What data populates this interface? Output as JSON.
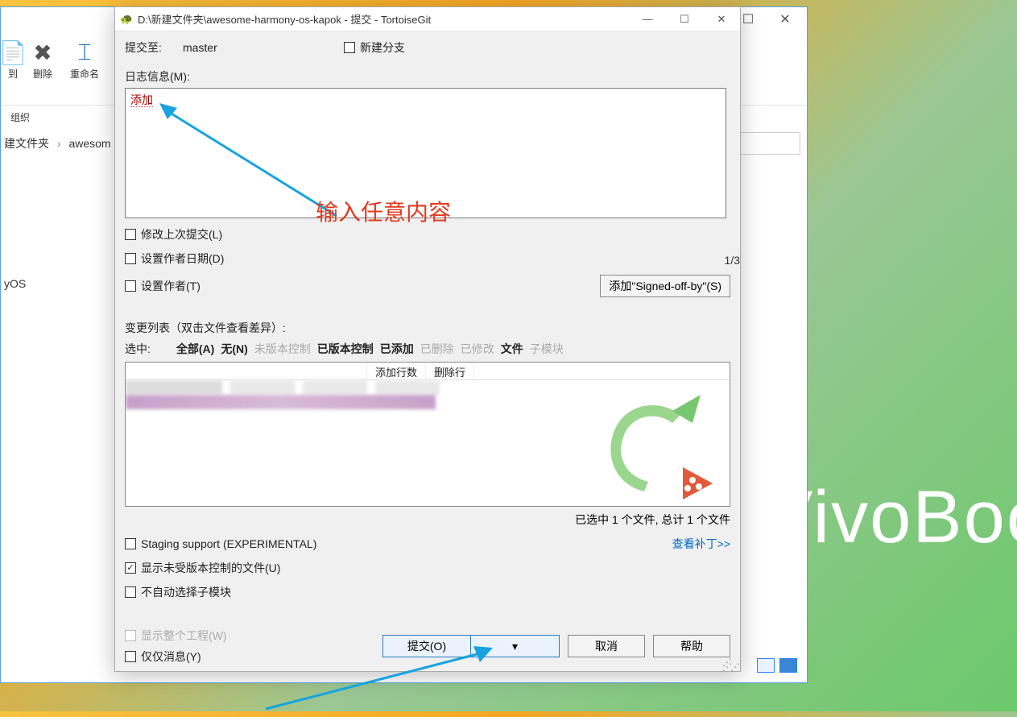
{
  "desktop": {
    "brand_text": "VivoBoo"
  },
  "explorer": {
    "ribbon": {
      "to_label": "到",
      "delete_label": "删除",
      "rename_label": "重命名",
      "group_label": "组织"
    },
    "breadcrumb": {
      "seg1": "建文件夹",
      "seg2": "awesom"
    },
    "sidebar_fragment": "yOS"
  },
  "dialog": {
    "title": "D:\\新建文件夹\\awesome-harmony-os-kapok - 提交 - TortoiseGit",
    "commit_to_label": "提交至:",
    "branch": "master",
    "new_branch_label": "新建分支",
    "log_label": "日志信息(M):",
    "message_text": "添加",
    "line_counter": "1/3",
    "amend_label": "修改上次提交(L)",
    "author_date_label": "设置作者日期(D)",
    "set_author_label": "设置作者(T)",
    "signed_off_btn": "添加\"Signed-off-by\"(S)",
    "changes_label": "变更列表（双击文件查看差异）:",
    "filter": {
      "selected": "选中:",
      "all": "全部(A)",
      "none": "无(N)",
      "unversioned": "未版本控制",
      "versioned": "已版本控制",
      "added": "已添加",
      "deleted": "已删除",
      "modified": "已修改",
      "files": "文件",
      "submodules": "子模块"
    },
    "columns": {
      "added_lines": "添加行数",
      "deleted_lines_partial": "删除行"
    },
    "status_selected": "已选中 1 个文件, 总计 1 个文件",
    "staging_label": "Staging support (EXPERIMENTAL)",
    "show_unversioned_label": "显示未受版本控制的文件(U)",
    "no_auto_submodule_label": "不自动选择子模块",
    "view_patch_link": "查看补丁>>",
    "show_whole_project_label": "显示整个工程(W)",
    "only_message_label": "仅仅消息(Y)",
    "commit_btn": "提交(O)",
    "cancel_btn": "取消",
    "help_btn": "帮助"
  },
  "annotation": {
    "text": "输入任意内容"
  }
}
